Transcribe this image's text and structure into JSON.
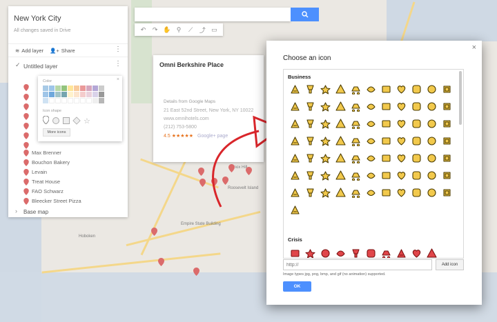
{
  "app": {
    "map_title": "New York City",
    "saved_status": "All changes saved in Drive",
    "add_layer_label": "Add layer",
    "share_label": "Share"
  },
  "layer": {
    "title": "Untitled layer",
    "items": [
      "Max Brenner",
      "Bouchon Bakery",
      "Levain",
      "Treat House",
      "FAO Schwarz",
      "Bleecker Street Pizza"
    ],
    "base_map_label": "Base map"
  },
  "color_popup": {
    "color_label": "Color",
    "icon_shape_label": "Icon shape",
    "more_icons_label": "More icons",
    "swatches": [
      "#a8cae6",
      "#9ec5e8",
      "#b7d7a8",
      "#93c47d",
      "#ffe599",
      "#f9cb9c",
      "#ea9999",
      "#d5a6bd",
      "#b4a7d6",
      "#cccccc",
      "#9fc5e8",
      "#6fa8dc",
      "#a2c4c9",
      "#76a5af",
      "#fff2cc",
      "#fce5cd",
      "#f4cccc",
      "#ead1dc",
      "#d9d2e9",
      "#999999",
      "#cfe2f3",
      "#ffffff",
      "#ffffff",
      "#ffffff",
      "#ffffff",
      "#ffffff",
      "#ffffff",
      "#ffffff",
      "#efefef",
      "#b7b7b7"
    ]
  },
  "info_card": {
    "place_name": "Omni Berkshire Place",
    "details_heading": "Details from Google Maps",
    "address": "21 East 52nd Street, New York, NY 10022",
    "website": "www.omnihotels.com",
    "phone": "(212) 753-5800",
    "rating": "4.5",
    "stars": "★★★★★",
    "gplus": "Google+ page"
  },
  "map_labels": [
    "Hoboken",
    "Empire State Building",
    "Lenox Hill",
    "Roosevelt Island"
  ],
  "dialog": {
    "title": "Choose an icon",
    "close_glyph": "×",
    "category_business": "Business",
    "category_crisis": "Crisis",
    "url_placeholder": "http://",
    "add_icon_label": "Add icon",
    "hint": "Image types jpg, png, bmp, and gif (no animation) supported.",
    "ok_label": "OK"
  },
  "colors": {
    "icon_fill": "#f2c94c",
    "icon_stroke": "#4a3b00",
    "crisis_fill": "#e0464a",
    "primary_blue": "#4d90fe",
    "arrow_red": "#d9262b",
    "pin_red": "#db6b6b"
  },
  "business_icons": [
    "dog",
    "atm",
    "bell",
    "dollar",
    "euro",
    "pound",
    "yen",
    "cocktail",
    "scissors",
    "bicycle",
    "book",
    "briefcase",
    "bus",
    "coffee",
    "camera",
    "car",
    "car-front",
    "tshirt",
    "film",
    "hanger",
    "moon",
    "ticket",
    "heart",
    "hospital",
    "hotel",
    "basketball",
    "chart",
    "flower",
    "cake",
    "baseball",
    "dice",
    "gas-pump",
    "gift",
    "tools",
    "bed",
    "house",
    "at-sign",
    "money-bag",
    "pen",
    "ship",
    "iron",
    "plus",
    "motorbike",
    "lock",
    "mailbox",
    "percent",
    "eye",
    "person",
    "flag",
    "paint",
    "phone",
    "tree",
    "ticket-fold",
    "pizza",
    "shop",
    "burger",
    "bird",
    "dog-2",
    "shopping-cart",
    "binoculars",
    "hand",
    "ice-cream",
    "scroll",
    "rectangle",
    "suitcase",
    "shoe",
    "basket",
    "heart-2",
    "search",
    "taxi",
    "bee",
    "smile",
    "ticket-2",
    "luggage",
    "tea",
    "train",
    "target",
    "rope"
  ],
  "crisis_icons": [
    "stretcher",
    "biohazard",
    "radiation",
    "warning",
    "fire-extinguisher",
    "megaphone",
    "gun",
    "storm",
    "cyclone",
    "skull"
  ]
}
